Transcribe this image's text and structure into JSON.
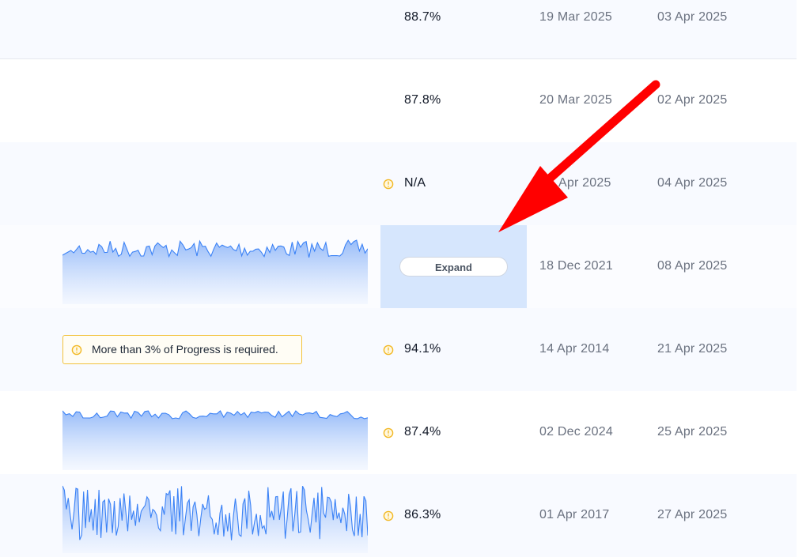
{
  "colors": {
    "accent_line": "#3b82f6",
    "warning": "#f2b824",
    "arrow": "#ff0000",
    "expand_highlight": "#d6e6fd"
  },
  "rows": [
    {
      "value": "88.7%",
      "start_date": "19 Mar 2025",
      "end_date": "03 Apr 2025"
    },
    {
      "value": "87.8%",
      "start_date": "20 Mar 2025",
      "end_date": "02 Apr 2025"
    },
    {
      "value": "N/A",
      "start_date": "Apr 2025",
      "end_date": "04 Apr 2025",
      "value_icon": "warning-circle-icon"
    },
    {
      "expand_label": "Expand",
      "start_date": "18 Dec 2021",
      "end_date": "08 Apr 2025",
      "sparkline": "area"
    },
    {
      "alert": "More than 3% of Progress is required.",
      "alert_icon": "warning-circle-icon",
      "value": "94.1%",
      "value_icon": "warning-circle-icon",
      "start_date": "14 Apr 2014",
      "end_date": "21 Apr 2025"
    },
    {
      "value": "87.4%",
      "value_icon": "warning-circle-icon",
      "start_date": "02 Dec 2024",
      "end_date": "25 Apr 2025",
      "sparkline": "area"
    },
    {
      "value": "86.3%",
      "value_icon": "warning-circle-icon",
      "start_date": "01 Apr 2017",
      "end_date": "27 Apr 2025",
      "sparkline": "area"
    }
  ],
  "annotation": {
    "type": "red-arrow",
    "points_to": "expand-button"
  }
}
